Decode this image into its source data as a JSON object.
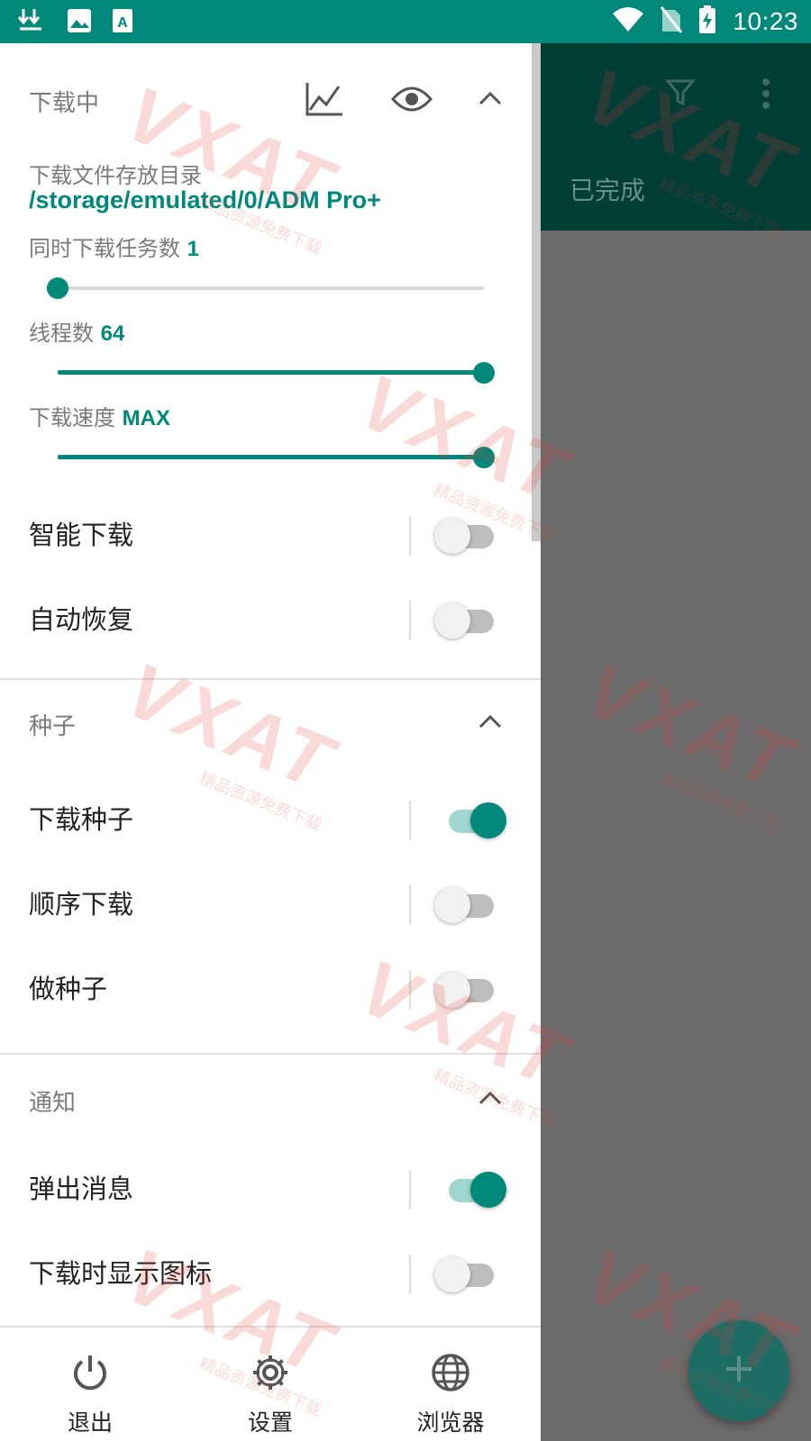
{
  "status_bar": {
    "time": "10:23",
    "icons": [
      "download-arrows-icon",
      "image-icon",
      "a-box-icon",
      "wifi-icon",
      "no-sim-icon",
      "battery-charging-icon"
    ]
  },
  "background_screen": {
    "tab_label": "已完成",
    "icons": [
      "filter-icon",
      "more-vert-icon",
      "add-icon"
    ]
  },
  "drawer": {
    "downloading": {
      "title": "下载中",
      "dir_label": "下载文件存放目录",
      "dir_path": "/storage/emulated/0/ADM Pro+",
      "concurrent_label": "同时下载任务数",
      "concurrent_value": "1",
      "concurrent_fraction": 0.0,
      "threads_label": "线程数",
      "threads_value": "64",
      "threads_fraction": 1.0,
      "speed_label": "下载速度",
      "speed_value": "MAX",
      "speed_fraction": 1.0,
      "toggles": [
        {
          "label": "智能下载",
          "on": false
        },
        {
          "label": "自动恢复",
          "on": false
        }
      ]
    },
    "torrent": {
      "title": "种子",
      "toggles": [
        {
          "label": "下载种子",
          "on": true
        },
        {
          "label": "顺序下载",
          "on": false
        },
        {
          "label": "做种子",
          "on": false
        }
      ]
    },
    "notification": {
      "title": "通知",
      "toggles": [
        {
          "label": "弹出消息",
          "on": true
        },
        {
          "label": "下载时显示图标",
          "on": false
        }
      ]
    }
  },
  "bottom_bar": {
    "exit_label": "退出",
    "settings_label": "设置",
    "browser_label": "浏览器"
  },
  "watermark": {
    "text": "VXAT",
    "sub": "精品资源免费下载"
  },
  "colors": {
    "accent": "#00897b",
    "status_bar": "#00897b",
    "behind_header": "#003d35",
    "scrim": "#6b6b6b"
  }
}
